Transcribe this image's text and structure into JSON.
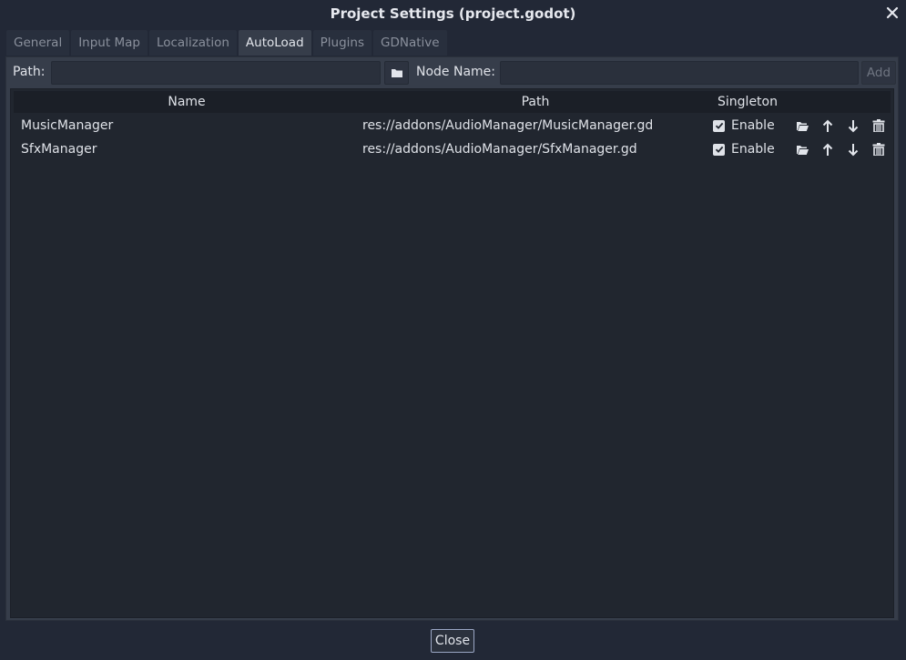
{
  "window": {
    "title": "Project Settings (project.godot)"
  },
  "tabs": [
    {
      "label": "General",
      "active": false
    },
    {
      "label": "Input Map",
      "active": false
    },
    {
      "label": "Localization",
      "active": false
    },
    {
      "label": "AutoLoad",
      "active": true
    },
    {
      "label": "Plugins",
      "active": false
    },
    {
      "label": "GDNative",
      "active": false
    }
  ],
  "toolbar": {
    "path_label": "Path:",
    "path_value": "",
    "node_name_label": "Node Name:",
    "node_name_value": "",
    "add_label": "Add"
  },
  "table": {
    "columns": [
      "Name",
      "Path",
      "Singleton"
    ],
    "rows": [
      {
        "name": "MusicManager",
        "path": "res://addons/AudioManager/MusicManager.gd",
        "singleton_label": "Enable",
        "enabled": true
      },
      {
        "name": "SfxManager",
        "path": "res://addons/AudioManager/SfxManager.gd",
        "singleton_label": "Enable",
        "enabled": true
      }
    ],
    "row_actions": [
      "open-folder-icon",
      "move-up-icon",
      "move-down-icon",
      "delete-icon"
    ]
  },
  "footer": {
    "close_label": "Close"
  },
  "colors": {
    "background": "#222836",
    "panel": "#363d4a",
    "tree": "#21262f",
    "text": "#dfe2e8",
    "accent_border": "#9aa6c4"
  }
}
